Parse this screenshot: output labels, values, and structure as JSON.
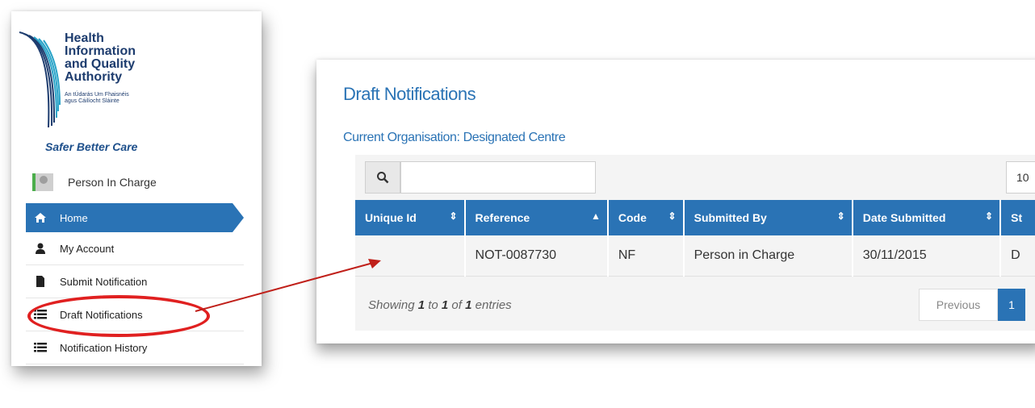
{
  "logo": {
    "title_lines": [
      "Health",
      "Information",
      "and Quality",
      "Authority"
    ],
    "irish_lines": [
      "An tÚdarás Um Fhaisnéis",
      "agus Cáilíocht Sláinte"
    ],
    "tagline": "Safer Better Care"
  },
  "user": {
    "name": "Person In Charge",
    "icon": "user-avatar"
  },
  "nav": {
    "items": [
      {
        "label": "Home",
        "icon": "home-icon",
        "active": true
      },
      {
        "label": "My Account",
        "icon": "user-icon"
      },
      {
        "label": "Submit Notification",
        "icon": "document-icon"
      },
      {
        "label": "Draft Notifications",
        "icon": "list-icon"
      },
      {
        "label": "Notification History",
        "icon": "list-icon"
      }
    ]
  },
  "main": {
    "title": "Draft Notifications",
    "organisation": "Current Organisation: Designated Centre",
    "search": {
      "value": "",
      "placeholder": ""
    },
    "page_length": "10",
    "table": {
      "headers": [
        "Unique Id",
        "Reference",
        "Code",
        "Submitted By",
        "Date Submitted",
        "St"
      ],
      "rows": [
        [
          "",
          "NOT-0087730",
          "NF",
          "Person in Charge",
          "30/11/2015",
          "D"
        ]
      ]
    },
    "info": {
      "prefix": "Showing ",
      "start": "1",
      "to": " to ",
      "end": "1",
      "of": " of ",
      "total": "1",
      "suffix": " entries"
    },
    "pagination": {
      "previous": "Previous",
      "current": "1"
    }
  },
  "colors": {
    "accent": "#2a73b5",
    "highlight": "#e02020",
    "brand": "#1d3c6e"
  }
}
